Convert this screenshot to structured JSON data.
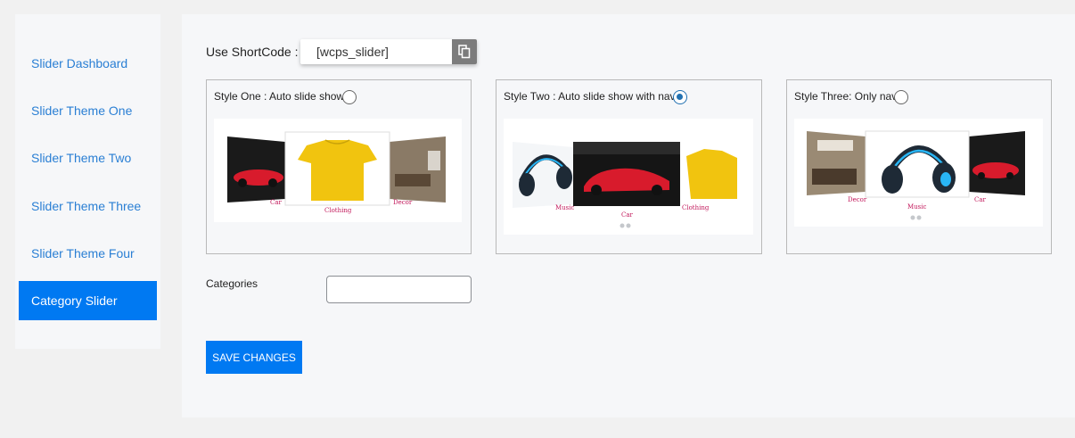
{
  "sidebar": {
    "items": [
      {
        "label": "Slider Dashboard"
      },
      {
        "label": "Slider Theme One"
      },
      {
        "label": "Slider Theme Two"
      },
      {
        "label": "Slider Theme Three"
      },
      {
        "label": "Slider Theme Four"
      },
      {
        "label": "Category Slider"
      }
    ],
    "active_item": "Category Slider"
  },
  "shortcode": {
    "label": "Use ShortCode :",
    "value": "[wcps_slider]",
    "copy_icon": "copy-icon"
  },
  "styles": [
    {
      "label": "Style One : Auto slide show",
      "selected": false,
      "captions": [
        "Car",
        "Clothing",
        "Decor"
      ]
    },
    {
      "label": "Style Two : Auto slide show with nav",
      "selected": true,
      "captions": [
        "Music",
        "Car",
        "Clothing"
      ]
    },
    {
      "label": "Style Three: Only nav",
      "selected": false,
      "captions": [
        "Decor",
        "Music",
        "Car"
      ]
    }
  ],
  "categories": {
    "label": "Categories",
    "value": ""
  },
  "save_button": {
    "label": "SAVE CHANGES"
  },
  "colors": {
    "accent": "#0079f2",
    "link": "#2a7fd4",
    "radio_checked": "#2271b1"
  }
}
